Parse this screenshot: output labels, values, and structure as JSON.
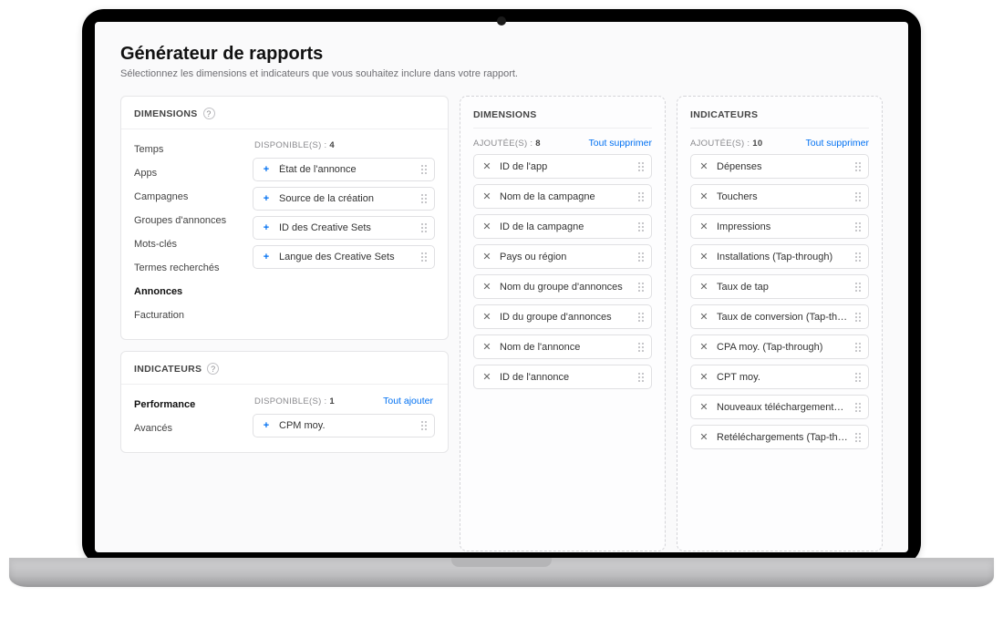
{
  "page": {
    "title": "Générateur de rapports",
    "subtitle": "Sélectionnez les dimensions et indicateurs que vous souhaitez inclure dans votre rapport."
  },
  "labels": {
    "available_prefix": "DISPONIBLE(S) : ",
    "added_prefix": "AJOUTÉE(S) : ",
    "add_all": "Tout ajouter",
    "remove_all": "Tout supprimer"
  },
  "dimensions_panel": {
    "title": "DIMENSIONS",
    "categories": [
      {
        "label": "Temps",
        "active": false
      },
      {
        "label": "Apps",
        "active": false
      },
      {
        "label": "Campagnes",
        "active": false
      },
      {
        "label": "Groupes d'annonces",
        "active": false
      },
      {
        "label": "Mots-clés",
        "active": false
      },
      {
        "label": "Termes recherchés",
        "active": false
      },
      {
        "label": "Annonces",
        "active": true
      },
      {
        "label": "Facturation",
        "active": false
      }
    ],
    "available_count": "4",
    "available_items": [
      "État de l'annonce",
      "Source de la création",
      "ID des Creative Sets",
      "Langue des Creative Sets"
    ]
  },
  "indicators_panel": {
    "title": "INDICATEURS",
    "categories": [
      {
        "label": "Performance",
        "active": true
      },
      {
        "label": "Avancés",
        "active": false
      }
    ],
    "available_count": "1",
    "available_items": [
      "CPM moy."
    ]
  },
  "dimensions_drop": {
    "title": "DIMENSIONS",
    "added_count": "8",
    "items": [
      "ID de l'app",
      "Nom de la campagne",
      "ID de la campagne",
      "Pays ou région",
      "Nom du groupe d'annonces",
      "ID du groupe d'annonces",
      "Nom de l'annonce",
      "ID de l'annonce"
    ]
  },
  "indicators_drop": {
    "title": "INDICATEURS",
    "added_count": "10",
    "items": [
      "Dépenses",
      "Touchers",
      "Impressions",
      "Installations (Tap-through)",
      "Taux de tap",
      "Taux de conversion (Tap-through)",
      "CPA moy. (Tap-through)",
      "CPT moy.",
      "Nouveaux téléchargements (Tap-thro...",
      "Retéléchargements (Tap-through)"
    ]
  }
}
